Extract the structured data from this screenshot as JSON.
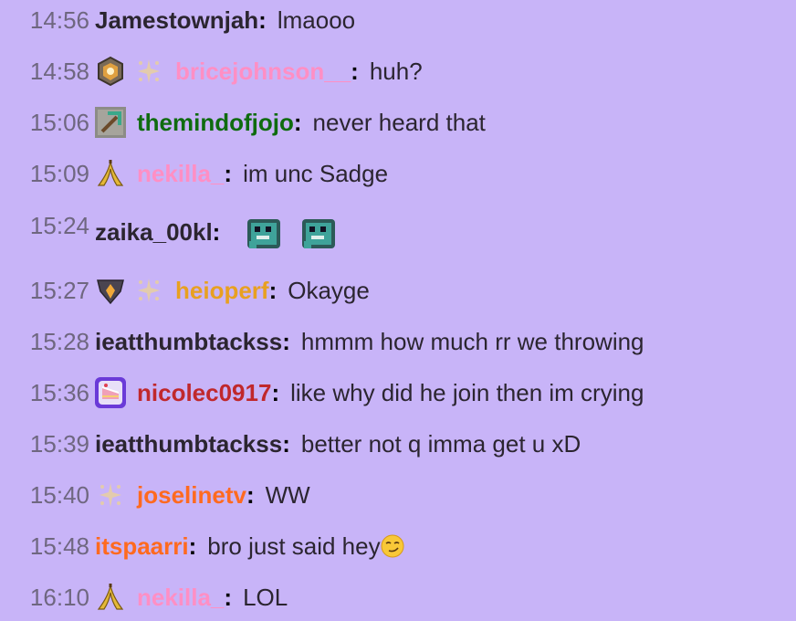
{
  "messages": [
    {
      "time": "14:56",
      "user": "Jamestownjah",
      "color": "#2b2530",
      "text": "lmaooo",
      "badges": []
    },
    {
      "time": "14:58",
      "user": "bricejohnson__",
      "color": "#ff8fc4",
      "text": "huh?",
      "badges": [
        "rank-medal-icon",
        "sparkle-badge-icon"
      ]
    },
    {
      "time": "15:06",
      "user": "themindofjojo",
      "color": "#0f6b0f",
      "text": "never heard that",
      "badges": [
        "pickaxe-icon"
      ]
    },
    {
      "time": "15:09",
      "user": "nekilla_",
      "color": "#ff8fc4",
      "text": "im unc Sadge",
      "badges": [
        "banana-icon"
      ]
    },
    {
      "time": "15:24",
      "user": "zaika_00kl",
      "color": "#2b2530",
      "text": "",
      "badges": [],
      "emotes": [
        "dino-emote-icon",
        "dino-emote-icon"
      ]
    },
    {
      "time": "15:27",
      "user": "heioperf",
      "color": "#e8a020",
      "text": "Okayge",
      "badges": [
        "rank-shield-icon",
        "sparkle-badge-icon"
      ]
    },
    {
      "time": "15:28",
      "user": "ieatthumbtackss",
      "color": "#2b2530",
      "text": "hmmm how much rr we throwing",
      "badges": []
    },
    {
      "time": "15:36",
      "user": "nicolec0917",
      "color": "#c0282c",
      "text": "like why did he join then im crying",
      "badges": [
        "cake-icon"
      ]
    },
    {
      "time": "15:39",
      "user": "ieatthumbtackss",
      "color": "#2b2530",
      "text": "better not q imma get u xD",
      "badges": []
    },
    {
      "time": "15:40",
      "user": "joselinetv",
      "color": "#ff6a1f",
      "text": "WW",
      "badges": [
        "sparkle-badge-icon"
      ]
    },
    {
      "time": "15:48",
      "user": "itspaarri",
      "color": "#ff6a1f",
      "text": "bro just said hey",
      "badges": [],
      "trailing_emoji": "smirk-emoji-icon"
    },
    {
      "time": "16:10",
      "user": "nekilla_",
      "color": "#ff8fc4",
      "text": "LOL",
      "badges": [
        "banana-icon"
      ]
    }
  ],
  "colors": {
    "background": "#c8b4f8",
    "timestamp": "#6f6780",
    "text": "#2b2530"
  }
}
